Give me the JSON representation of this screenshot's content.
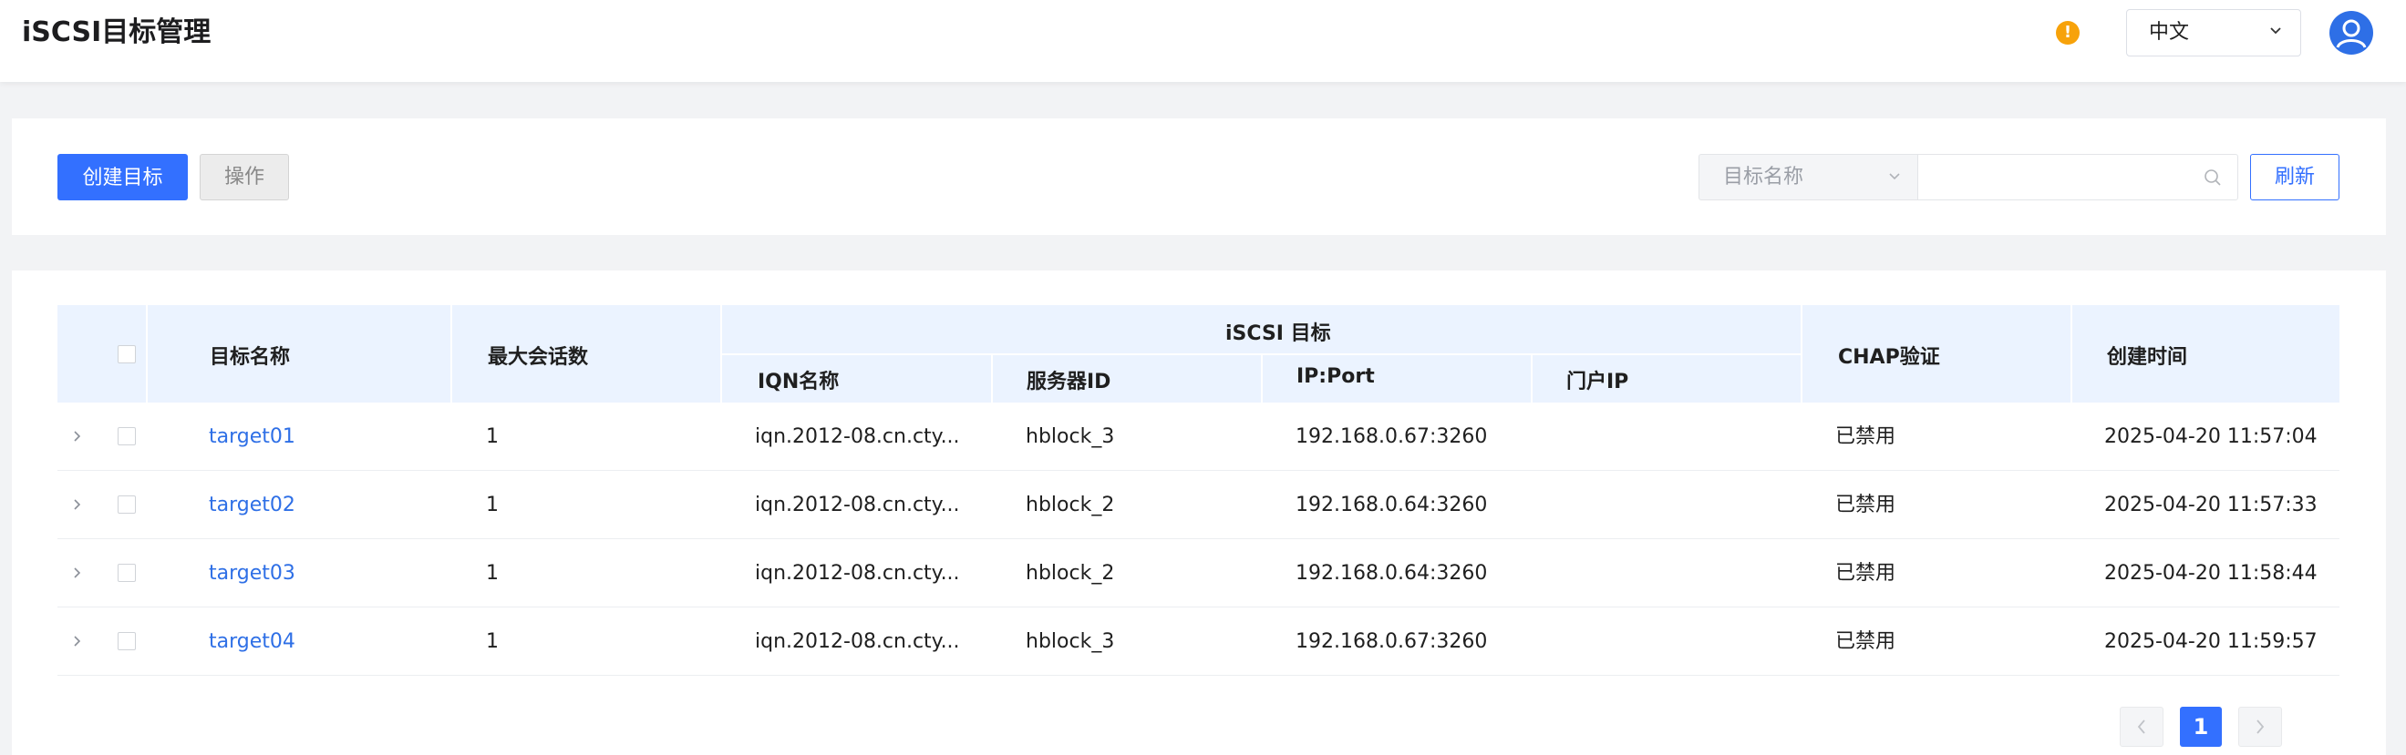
{
  "header": {
    "title": "iSCSI目标管理",
    "warning_icon": "warning-icon",
    "warning_glyph": "!",
    "language": "中文",
    "avatar_icon": "user-avatar-icon"
  },
  "toolbar": {
    "create_label": "创建目标",
    "operate_label": "操作",
    "filter_field": "目标名称",
    "search_value": "",
    "refresh_label": "刷新"
  },
  "table": {
    "headers": {
      "name": "目标名称",
      "max_sessions": "最大会话数",
      "group": "iSCSI 目标",
      "iqn": "IQN名称",
      "server_id": "服务器ID",
      "ip_port": "IP:Port",
      "portal_ip": "门户IP",
      "chap": "CHAP验证",
      "created": "创建时间"
    },
    "rows": [
      {
        "name": "target01",
        "max_sessions": "1",
        "iqn": "iqn.2012-08.cn.cty...",
        "server_id": "hblock_3",
        "ip_port": "192.168.0.67:3260",
        "portal_ip": "",
        "chap": "已禁用",
        "created": "2025-04-20 11:57:04"
      },
      {
        "name": "target02",
        "max_sessions": "1",
        "iqn": "iqn.2012-08.cn.cty...",
        "server_id": "hblock_2",
        "ip_port": "192.168.0.64:3260",
        "portal_ip": "",
        "chap": "已禁用",
        "created": "2025-04-20 11:57:33"
      },
      {
        "name": "target03",
        "max_sessions": "1",
        "iqn": "iqn.2012-08.cn.cty...",
        "server_id": "hblock_2",
        "ip_port": "192.168.0.64:3260",
        "portal_ip": "",
        "chap": "已禁用",
        "created": "2025-04-20 11:58:44"
      },
      {
        "name": "target04",
        "max_sessions": "1",
        "iqn": "iqn.2012-08.cn.cty...",
        "server_id": "hblock_3",
        "ip_port": "192.168.0.67:3260",
        "portal_ip": "",
        "chap": "已禁用",
        "created": "2025-04-20 11:59:57"
      }
    ]
  },
  "pagination": {
    "current_page": "1"
  },
  "colors": {
    "primary": "#3370ff",
    "link": "#2e6fe6",
    "warning": "#f7a20a",
    "table_header_bg": "#ebf3ff"
  }
}
